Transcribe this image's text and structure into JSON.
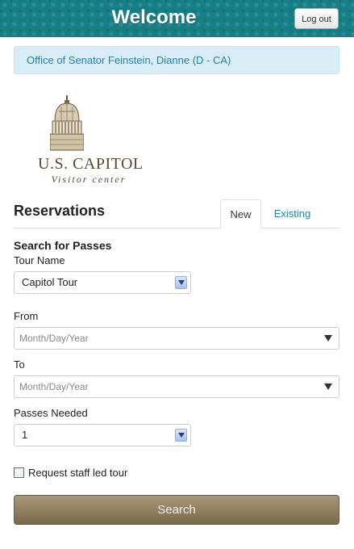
{
  "header": {
    "title": "Welcome",
    "logout_label": "Log out"
  },
  "office_notice": "Office of Senator Feinstein, Dianne (D - CA)",
  "logo": {
    "line1": "U.S. CAPITOL",
    "line2": "Visitor center"
  },
  "reservations": {
    "title": "Reservations",
    "tabs": [
      {
        "label": "New",
        "active": true
      },
      {
        "label": "Existing",
        "active": false
      }
    ]
  },
  "search_form": {
    "section_title": "Search for Passes",
    "tour_name": {
      "label": "Tour Name",
      "value": "Capitol Tour"
    },
    "from": {
      "label": "From",
      "placeholder": "Month/Day/Year"
    },
    "to": {
      "label": "To",
      "placeholder": "Month/Day/Year"
    },
    "passes": {
      "label": "Passes Needed",
      "value": "1"
    },
    "staff_tour": {
      "label": "Request staff led tour",
      "checked": false
    },
    "search_label": "Search"
  },
  "colors": {
    "header_bg": "#167f86",
    "link": "#1a87b0",
    "notice_bg": "#d9edf7",
    "search_button": "#8e7e5e"
  }
}
